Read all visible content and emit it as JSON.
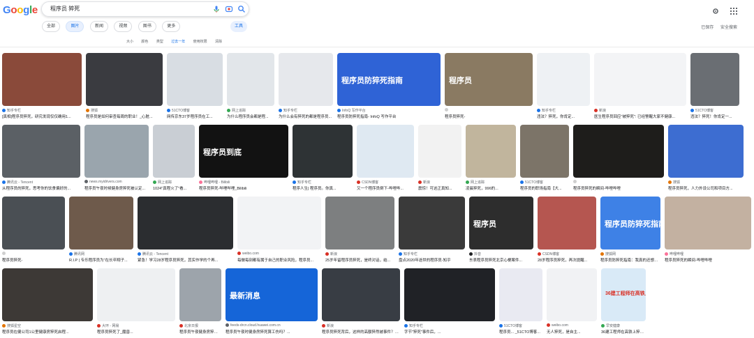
{
  "search": {
    "query": "程序员 猝死"
  },
  "tabs": [
    "全部",
    "图片",
    "新闻",
    "视频",
    "图书",
    "更多"
  ],
  "tools_label": "工具",
  "right_links": [
    "已保存",
    "安全搜索"
  ],
  "filters": [
    "大小",
    "颜色",
    "类型",
    "过去一年",
    "使用权限",
    "清除"
  ],
  "images": [
    {
      "source": "知乎专栏",
      "title": "[真相]程序员猝死，研究发现仅仅确用1...",
      "color": "#8a4a3a",
      "fav": "#1a73e8"
    },
    {
      "source": "搜狐",
      "title": "程序员是如何审查每周的职业！_心脏...",
      "color": "#3a3b40",
      "fav": "#e37400"
    },
    {
      "source": "51CTO博客",
      "title": "网传京东37岁程序员在工...",
      "color": "#d8dde3",
      "fav": "#1a73e8"
    },
    {
      "source": "网上追踪",
      "title": "为什么程序员会都是程...",
      "color": "#e2e6ea",
      "fav": "#34a853"
    },
    {
      "source": "知乎专栏",
      "title": "为什么会有猝死的都是程序员...",
      "color": "#e6e8ec",
      "fav": "#1a73e8"
    },
    {
      "source": "InfoQ 写作平台",
      "title": "程序员防猝死指南- InfoQ 写作平台",
      "color": "#2f63d6",
      "fav": "#1a73e8",
      "overlay": "程序员防猝死指南"
    },
    {
      "source": "",
      "title": "程序员猝死-",
      "color": "#8a7a62",
      "fav": "#cfcfcf",
      "overlay": "程序员"
    },
    {
      "source": "知乎专栏",
      "title": "违法？猝死，你肯定...",
      "color": "#eef1f4",
      "fav": "#1a73e8"
    },
    {
      "source": "新浪",
      "title": "医生程序员回应\"被猝死\": 已经警醒大家不健康...",
      "color": "#f3f4f6",
      "fav": "#d93025"
    },
    {
      "source": "51CTO博客",
      "title": "违法？猝死！你肯定一...",
      "color": "#6a6e73",
      "fav": "#1a73e8"
    },
    {
      "source": "腾讯云 - Tencent",
      "title": "从程序员的猝死，思考你的饮食偏好的...",
      "color": "#5b6065",
      "fav": "#1a73e8"
    },
    {
      "source": "news.myidrivers.com",
      "title": "程序员午夜时候健身房猝死被认定...",
      "color": "#9aa5ad",
      "fav": "#5f6368"
    },
    {
      "source": "网上追踪",
      "title": "1024\"真程火了\"看...",
      "color": "#c9ced4",
      "fav": "#34a853"
    },
    {
      "source": "哔哩哔哩 - Bilibili",
      "title": "程序员猝死-哔哩哔哩_Bilibili",
      "color": "#121212",
      "fav": "#fb7299",
      "overlay": "程序员到底"
    },
    {
      "source": "知乎专栏",
      "title": "程序人生| 程序员。你真...",
      "color": "#2e3335",
      "fav": "#1a73e8"
    },
    {
      "source": "CSDN博客",
      "title": "又一个程序员倒下-哔哩哔...",
      "color": "#dfe9f2",
      "fav": "#d93025"
    },
    {
      "source": "新浪",
      "title": "震惊！可这正真知...",
      "color": "#f2f2f2",
      "fav": "#d93025"
    },
    {
      "source": "网上追踪",
      "title": "凌晨猝死，996的...",
      "color": "#c1b59d",
      "fav": "#34a853"
    },
    {
      "source": "51CTO博客",
      "title": "程序员的职场指南【大...",
      "color": "#7c7468",
      "fav": "#1a73e8"
    },
    {
      "source": "",
      "title": "程序员猝死的瞬间-哔哩哔哩",
      "color": "#1e1d1b",
      "fav": "#cfcfcf"
    },
    {
      "source": "搜狐",
      "title": "程序员猝死，人力外设公司和项目方...",
      "color": "#3d6dd1",
      "fav": "#e37400"
    },
    {
      "source": "",
      "title": "程序员猝死-",
      "color": "#4a4f54",
      "fav": "#cfcfcf"
    },
    {
      "source": "腾讯网",
      "title": "R.I.P | 专乐程序员为\"在长卒翔子...",
      "color": "#6e5a4b",
      "fav": "#1a73e8"
    },
    {
      "source": "腾讯云 - Tencent",
      "title": "紧急！学习28岁程序员猝死，其实作学的个再...",
      "color": "#2b2d30",
      "fav": "#1a73e8"
    },
    {
      "source": "weibo.com",
      "title": "每做每刻都有属于自己的职业风险，程序员...",
      "color": "#f2f3f5",
      "fav": "#d93025"
    },
    {
      "source": "新浪",
      "title": "25岁年留程序员猝死，是终对话，结...",
      "color": "#7d7f80",
      "fav": "#d93025"
    },
    {
      "source": "知乎专栏",
      "title": "盘点2020年逝世的程序员-知乎",
      "color": "#3a3a3a",
      "fav": "#1a73e8"
    },
    {
      "source": "抖音",
      "title": "东表程序员猝死北京心梗案件...",
      "color": "#2d2d2d",
      "fav": "#202124",
      "overlay": "程序员"
    },
    {
      "source": "CSDN博客",
      "title": "28岁程序员猝死，再次提醒...",
      "color": "#b55650",
      "fav": "#d93025"
    },
    {
      "source": "搜狐网",
      "title": "程序员防猝死指南：我真的还想再活500年！...",
      "color": "#3e81e6",
      "fav": "#e37400",
      "overlay": "程序员防猝死指南"
    },
    {
      "source": "哔哩哔哩",
      "title": "程序员猝死的瞬间-哔哩哔哩",
      "color": "#c3b1a1",
      "fav": "#fb7299"
    },
    {
      "source": "搜狐星空",
      "title": "程序员在健公司1公里健康房猝死启程...",
      "color": "#3d3936",
      "fav": "#e37400"
    },
    {
      "source": "大环 - 网易",
      "title": "程序员猝死了_魔兽...",
      "color": "#eef0f2",
      "fav": "#d93025"
    },
    {
      "source": "北京日报",
      "title": "程序员午夜健身房猝死算工伤吗？海淀法院案...",
      "color": "#9da4ab",
      "fav": "#d93025"
    },
    {
      "source": "feeds-drcn.cloud.huawei.com.cn",
      "title": "程序员午夜时健身房猝死算工伤吗？...",
      "color": "#1565d8",
      "fav": "#5f6368",
      "overlay": "最新消息"
    },
    {
      "source": "新浪",
      "title": "程序员猝死背后，这样的高额猝然被事件？网...",
      "color": "#383d44",
      "fav": "#d93025"
    },
    {
      "source": "知乎专栏",
      "title": "字节\"猝死\"事件后，...",
      "color": "#202226",
      "fav": "#1a73e8"
    },
    {
      "source": "51CTO博客",
      "title": "程序员... _51CTO博客...",
      "color": "#e9eaf2",
      "fav": "#1a73e8"
    },
    {
      "source": "weibo.com",
      "title": "无人猝死，是自主...",
      "color": "#f1f2f4",
      "fav": "#d93025"
    },
    {
      "source": "早安健康",
      "title": "36建工程师在高铁上猝死！...",
      "color": "#d9eaf7",
      "fav": "#34a853",
      "overlay": "36建工程师在高铁上猝死！"
    }
  ]
}
